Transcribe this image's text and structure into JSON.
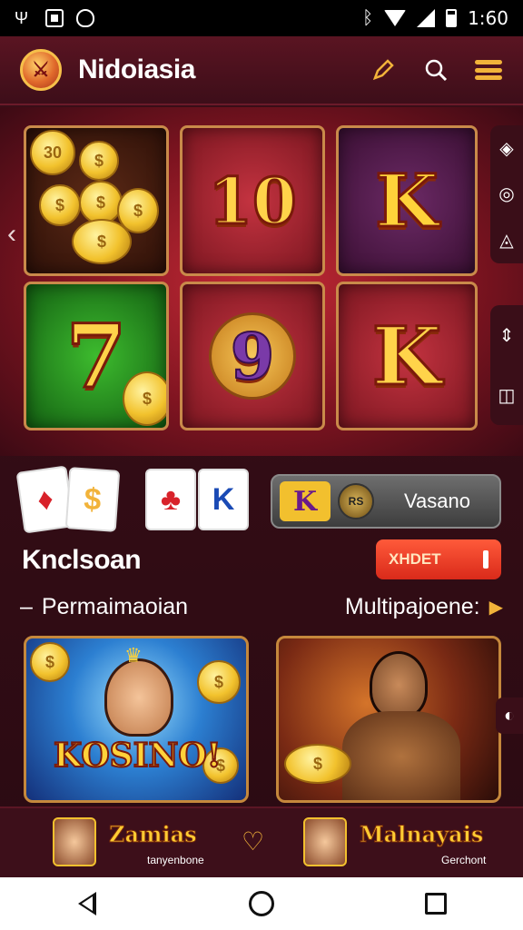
{
  "status_bar": {
    "time": "1:60"
  },
  "header": {
    "brand": "Nidoiasia",
    "icons": [
      "logo-icon",
      "pencil-icon",
      "search-icon",
      "menu-icon"
    ]
  },
  "slots": {
    "tiles": [
      {
        "symbol": "",
        "icon": "coins-icon"
      },
      {
        "symbol": "10"
      },
      {
        "symbol": "K"
      },
      {
        "symbol": "7"
      },
      {
        "symbol": "9"
      },
      {
        "symbol": "K"
      }
    ],
    "coin_labels": [
      "30"
    ]
  },
  "promo": {
    "cards": [
      "",
      "$",
      "",
      "K"
    ],
    "pill_k": "K",
    "pill_badge": "RS",
    "pill_label": "Vasano"
  },
  "section": {
    "title": "Knclsoan",
    "cta_label": "XHDET",
    "left_link": "Permaimaoian",
    "right_link": "Multipajoene:"
  },
  "games": [
    {
      "art_text": "KOSINO!",
      "coin": "$"
    },
    {
      "art_text": "",
      "coin": "$"
    }
  ],
  "listing": [
    {
      "title": "Zamias",
      "subtitle": "tanyenbone"
    },
    {
      "title": "Malnayais",
      "subtitle": "Gerchont"
    }
  ],
  "colors": {
    "accent": "#f2b33a",
    "brand_bg": "#3d0e19",
    "cta": "#e23a26"
  }
}
